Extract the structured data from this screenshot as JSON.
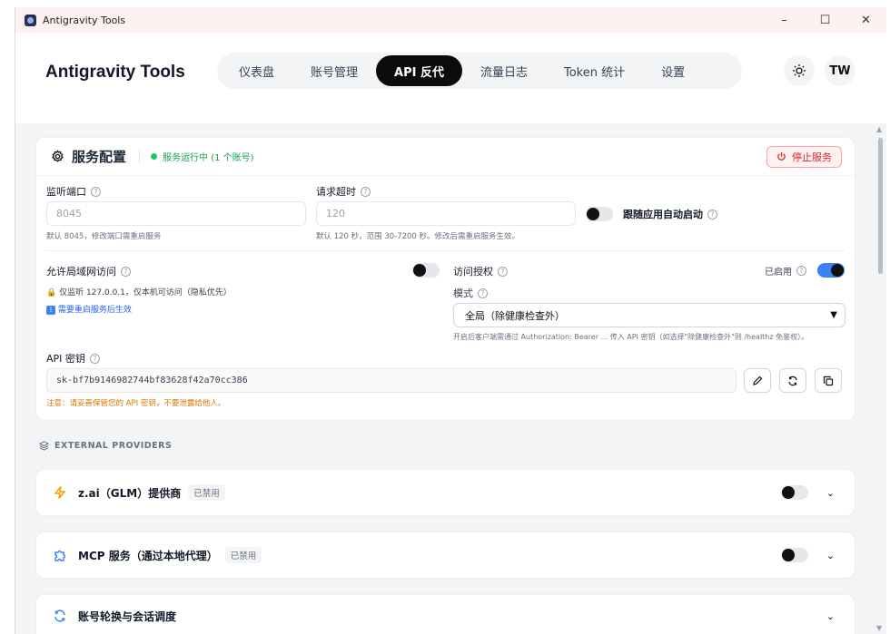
{
  "window": {
    "title": "Antigravity Tools",
    "minimize": "–",
    "maximize": "☐",
    "close": "✕"
  },
  "header": {
    "brand": "Antigravity Tools",
    "nav": [
      {
        "label": "仪表盘"
      },
      {
        "label": "账号管理"
      },
      {
        "label": "API 反代"
      },
      {
        "label": "流量日志"
      },
      {
        "label": "Token 统计"
      },
      {
        "label": "设置"
      }
    ],
    "active_nav": "API 反代",
    "theme_icon": "sun-icon",
    "avatar": "TW"
  },
  "service": {
    "title": "服务配置",
    "status": "服务运行中 (1 个账号)",
    "stop_label": "停止服务",
    "port_label": "监听端口",
    "port_value": "8045",
    "port_hint": "默认 8045，修改端口需重启服务",
    "timeout_label": "请求超时",
    "timeout_value": "120",
    "timeout_hint": "默认 120 秒，范围 30-7200 秒。修改后需重启服务生效。",
    "autostart_label": "跟随应用自动启动",
    "autostart_on": false,
    "lan_label": "允许局域网访问",
    "lan_on": false,
    "lan_hint": "仅监听 127.0.0.1，仅本机可访问（隐私优先）",
    "restart_hint": "需要重启服务后生效",
    "auth_label": "访问授权",
    "auth_state": "已启用",
    "auth_on": true,
    "mode_label": "模式",
    "mode_value": "全局（除健康检查外）",
    "mode_hint": "开启后客户端需通过 Authorization: Bearer ... 传入 API 密钥（如选择\"除健康检查外\"则 /healthz 免鉴权）。",
    "apikey_label": "API 密钥",
    "apikey_value": "sk-bf7b9146982744bf83628f42a70cc386",
    "apikey_warning": "注意：请妥善保管您的 API 密钥，不要泄露给他人。"
  },
  "providers": {
    "section_title": "EXTERNAL PROVIDERS",
    "items": [
      {
        "name": "z.ai（GLM）提供商",
        "badge": "已禁用",
        "icon": "bolt-icon"
      },
      {
        "name": "MCP 服务（通过本地代理）",
        "badge": "已禁用",
        "icon": "puzzle-icon"
      },
      {
        "name": "账号轮换与会话调度",
        "badge": "",
        "icon": "refresh-icon"
      }
    ]
  },
  "colors": {
    "accent": "#3b82f6",
    "success": "#22c55e",
    "danger": "#dc2626",
    "active_nav": "#0b0b0b"
  }
}
